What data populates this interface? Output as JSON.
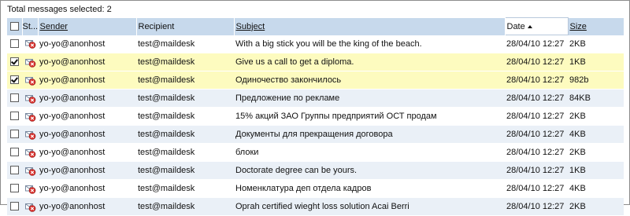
{
  "summary": {
    "label": "Total messages selected: 2"
  },
  "columns": {
    "status": "St...",
    "sender": "Sender",
    "recipient": "Recipient",
    "subject": "Subject",
    "date": "Date",
    "size": "Size"
  },
  "colors": {
    "header_bg": "#c7d9ec",
    "row_alt_bg": "#eaf0f7",
    "selected_bg": "#fdfbbf",
    "status_icon": "#d9302c"
  },
  "messages": [
    {
      "checked": false,
      "sender": "yo-yo@anonhost",
      "recipient": "test@maildesk",
      "subject": "With a big stick you will be the king of the beach.",
      "date": "28/04/10 12:27",
      "size": "2KB"
    },
    {
      "checked": true,
      "sender": "yo-yo@anonhost",
      "recipient": "test@maildesk",
      "subject": "Give us a call to get a diploma.",
      "date": "28/04/10 12:27",
      "size": "1KB"
    },
    {
      "checked": true,
      "sender": "yo-yo@anonhost",
      "recipient": "test@maildesk",
      "subject": "Одиночество закончилось",
      "date": "28/04/10 12:27",
      "size": "982b"
    },
    {
      "checked": false,
      "sender": "yo-yo@anonhost",
      "recipient": "test@maildesk",
      "subject": "Предложение по рекламе",
      "date": "28/04/10 12:27",
      "size": "84KB"
    },
    {
      "checked": false,
      "sender": "yo-yo@anonhost",
      "recipient": "test@maildesk",
      "subject": "15% акций ЗАО Группы предприятий ОСТ продам",
      "date": "28/04/10 12:27",
      "size": "2KB"
    },
    {
      "checked": false,
      "sender": "yo-yo@anonhost",
      "recipient": "test@maildesk",
      "subject": "Документы для прекращения договора",
      "date": "28/04/10 12:27",
      "size": "4KB"
    },
    {
      "checked": false,
      "sender": "yo-yo@anonhost",
      "recipient": "test@maildesk",
      "subject": "блоки",
      "date": "28/04/10 12:27",
      "size": "2KB"
    },
    {
      "checked": false,
      "sender": "yo-yo@anonhost",
      "recipient": "test@maildesk",
      "subject": "Doctorate degree can be yours.",
      "date": "28/04/10 12:27",
      "size": "1KB"
    },
    {
      "checked": false,
      "sender": "yo-yo@anonhost",
      "recipient": "test@maildesk",
      "subject": "Номенклатура деп отдела кадров",
      "date": "28/04/10 12:27",
      "size": "4KB"
    },
    {
      "checked": false,
      "sender": "yo-yo@anonhost",
      "recipient": "test@maildesk",
      "subject": "Oprah certified wieght loss solution Acai Berri",
      "date": "28/04/10 12:27",
      "size": "2KB"
    }
  ]
}
